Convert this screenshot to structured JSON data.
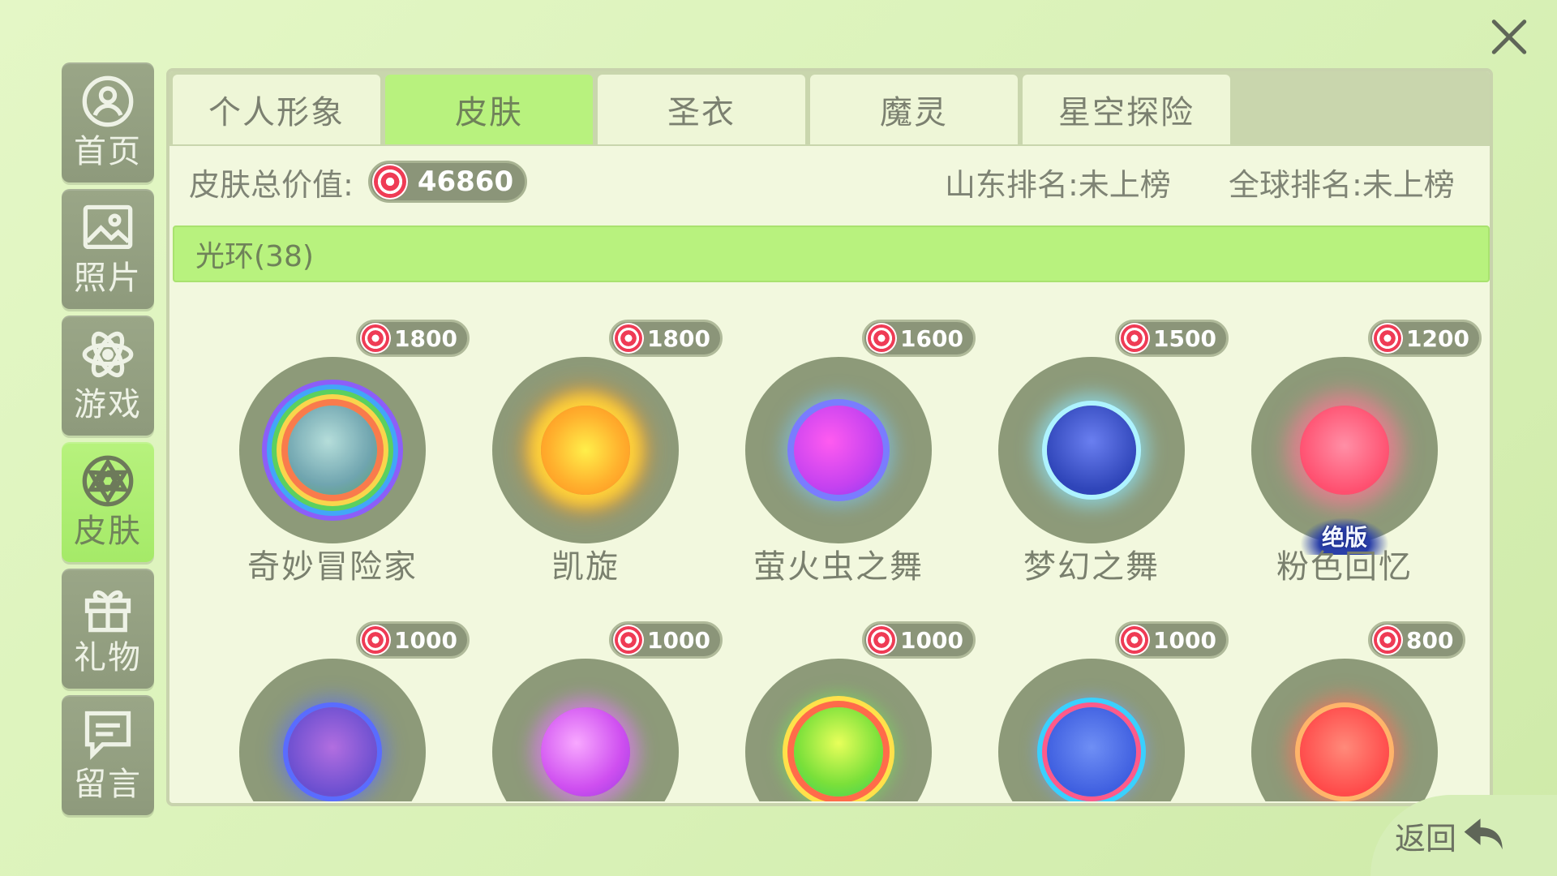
{
  "colors": {
    "accent": "#b8f27e",
    "sidebar": "#9aa687",
    "background": "#dff4c0",
    "badge": "#8b9579"
  },
  "sidebar": {
    "items": [
      {
        "label": "首页",
        "icon": "user-icon",
        "active": false
      },
      {
        "label": "照片",
        "icon": "photo-icon",
        "active": false
      },
      {
        "label": "游戏",
        "icon": "atom-icon",
        "active": false
      },
      {
        "label": "皮肤",
        "icon": "skin-icon",
        "active": true
      },
      {
        "label": "礼物",
        "icon": "gift-icon",
        "active": false
      },
      {
        "label": "留言",
        "icon": "message-icon",
        "active": false
      }
    ]
  },
  "tabs": [
    {
      "label": "个人形象",
      "active": false
    },
    {
      "label": "皮肤",
      "active": true
    },
    {
      "label": "圣衣",
      "active": false
    },
    {
      "label": "魔灵",
      "active": false
    },
    {
      "label": "星空探险",
      "active": false
    }
  ],
  "summary": {
    "total_label": "皮肤总价值:",
    "total_value": "46860",
    "province_rank": "山东排名:未上榜",
    "global_rank": "全球排名:未上榜"
  },
  "category": {
    "label": "光环(38)"
  },
  "items": [
    {
      "name": "奇妙冒险家",
      "price": "1800",
      "limited": false
    },
    {
      "name": "凯旋",
      "price": "1800",
      "limited": false
    },
    {
      "name": "萤火虫之舞",
      "price": "1600",
      "limited": false
    },
    {
      "name": "梦幻之舞",
      "price": "1500",
      "limited": false
    },
    {
      "name": "粉色回忆",
      "price": "1200",
      "limited": true
    },
    {
      "name": "",
      "price": "1000",
      "limited": false
    },
    {
      "name": "",
      "price": "1000",
      "limited": true
    },
    {
      "name": "",
      "price": "1000",
      "limited": true
    },
    {
      "name": "",
      "price": "1000",
      "limited": false
    },
    {
      "name": "",
      "price": "800",
      "limited": true
    }
  ],
  "limited_label": "绝版",
  "back_label": "返回"
}
